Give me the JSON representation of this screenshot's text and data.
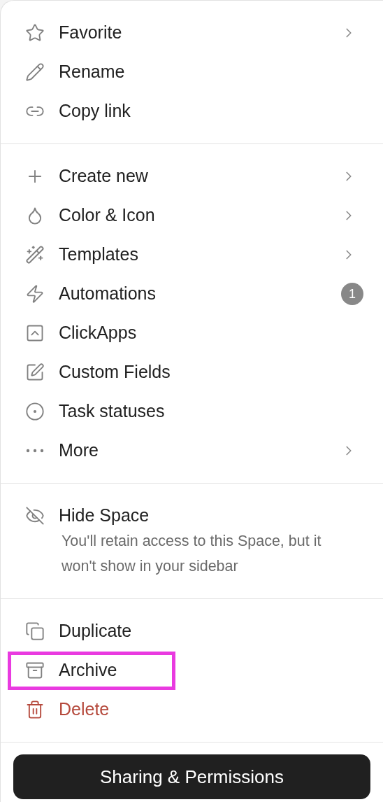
{
  "sections": [
    {
      "items": [
        {
          "label": "Favorite",
          "submenu": true,
          "kind": "normal",
          "highlighted": false
        },
        {
          "label": "Rename",
          "submenu": false,
          "kind": "normal",
          "highlighted": false
        },
        {
          "label": "Copy link",
          "submenu": false,
          "kind": "normal",
          "highlighted": false
        }
      ]
    },
    {
      "items": [
        {
          "label": "Create new",
          "submenu": true,
          "kind": "normal",
          "highlighted": false
        },
        {
          "label": "Color & Icon",
          "submenu": true,
          "kind": "normal",
          "highlighted": false
        },
        {
          "label": "Templates",
          "submenu": true,
          "kind": "normal",
          "highlighted": false
        },
        {
          "label": "Automations",
          "submenu": false,
          "kind": "normal",
          "badge": "1",
          "highlighted": false
        },
        {
          "label": "ClickApps",
          "submenu": false,
          "kind": "normal",
          "highlighted": false
        },
        {
          "label": "Custom Fields",
          "submenu": false,
          "kind": "normal",
          "highlighted": false
        },
        {
          "label": "Task statuses",
          "submenu": false,
          "kind": "normal",
          "highlighted": false
        },
        {
          "label": "More",
          "submenu": true,
          "kind": "normal",
          "highlighted": false
        }
      ]
    },
    {
      "items": [
        {
          "label": "Hide Space",
          "submenu": false,
          "kind": "normal",
          "description": "You'll retain access to this Space, but it won't show in your sidebar",
          "highlighted": false
        }
      ]
    },
    {
      "items": [
        {
          "label": "Duplicate",
          "submenu": false,
          "kind": "normal",
          "highlighted": false
        },
        {
          "label": "Archive",
          "submenu": false,
          "kind": "normal",
          "highlighted": true
        },
        {
          "label": "Delete",
          "submenu": false,
          "kind": "danger",
          "highlighted": false
        }
      ]
    }
  ],
  "footer_button": "Sharing & Permissions"
}
